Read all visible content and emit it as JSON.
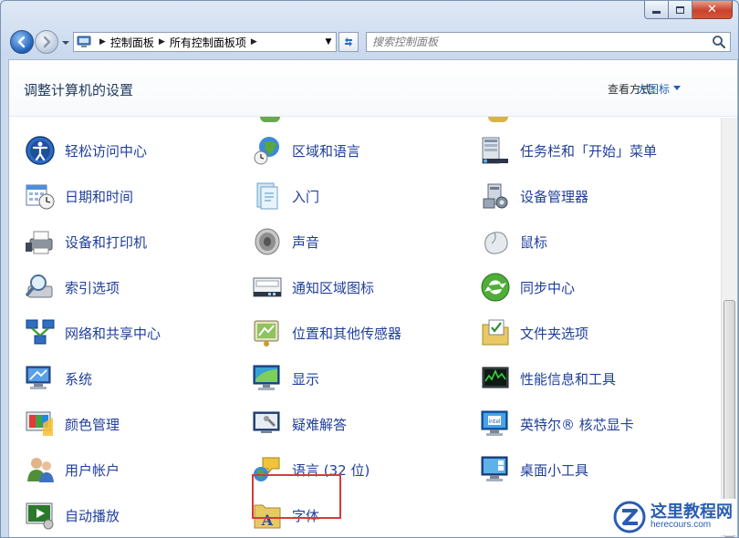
{
  "address": {
    "segments": [
      "控制面板",
      "所有控制面板项"
    ]
  },
  "search": {
    "placeholder": "搜索控制面板"
  },
  "header": {
    "title": "调整计算机的设置",
    "view_by_label": "查看方式:",
    "view_by_value": "大图标"
  },
  "items": [
    [
      "轻松访问中心",
      "区域和语言",
      "任务栏和「开始」菜单"
    ],
    [
      "日期和时间",
      "入门",
      "设备管理器"
    ],
    [
      "设备和打印机",
      "声音",
      "鼠标"
    ],
    [
      "索引选项",
      "通知区域图标",
      "同步中心"
    ],
    [
      "网络和共享中心",
      "位置和其他传感器",
      "文件夹选项"
    ],
    [
      "系统",
      "显示",
      "性能信息和工具"
    ],
    [
      "颜色管理",
      "疑难解答",
      "英特尔® 核芯显卡"
    ],
    [
      "用户帐户",
      "语言 (32 位)",
      "桌面小工具"
    ],
    [
      "自动播放",
      "字体"
    ]
  ],
  "watermark": {
    "title": "这里教程网",
    "url": "herecours.com"
  },
  "colors": {
    "link": "#1f3f9a",
    "title": "#1e395b",
    "highlight": "#d73a3a"
  }
}
